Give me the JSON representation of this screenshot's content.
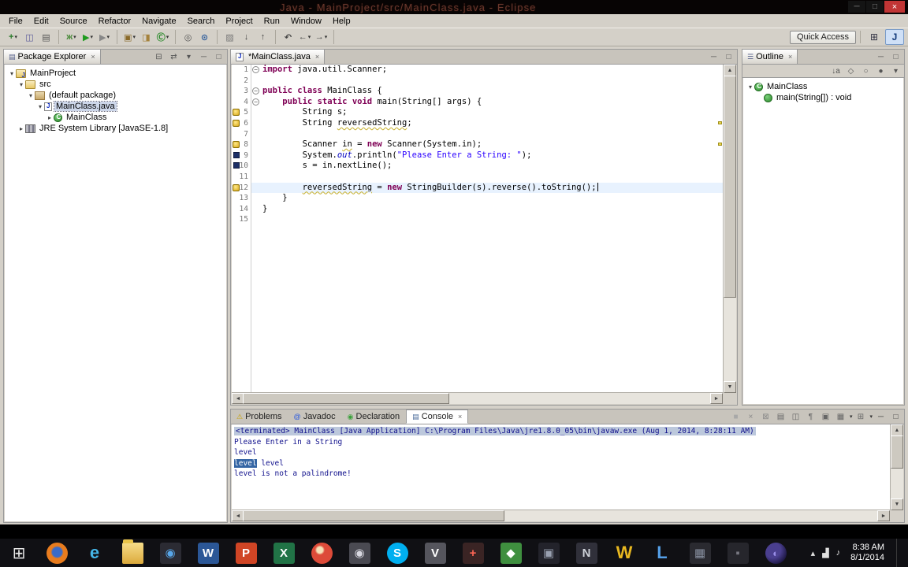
{
  "window": {
    "title": "Java - MainProject/src/MainClass.java - Eclipse",
    "controls": {
      "minimize": "─",
      "maximize": "□",
      "close": "×"
    }
  },
  "menu_bar": {
    "items": [
      "File",
      "Edit",
      "Source",
      "Refactor",
      "Navigate",
      "Search",
      "Project",
      "Run",
      "Window",
      "Help"
    ]
  },
  "toolbar": {
    "quick_access": "Quick Access",
    "perspectives": [
      {
        "name": "open-perspective",
        "glyph": "⊞",
        "active": false
      },
      {
        "name": "java-perspective",
        "glyph": "J",
        "active": true
      }
    ],
    "groups": [
      [
        {
          "name": "new-wizard",
          "glyph": "+",
          "fg": "#2a7a2a",
          "dd": true
        },
        {
          "name": "save",
          "glyph": "◫",
          "fg": "#5a5a9a"
        },
        {
          "name": "print",
          "glyph": "▤",
          "fg": "#555555"
        }
      ],
      [
        {
          "name": "debug",
          "glyph": "ж",
          "fg": "#4a8a3a",
          "dd": true
        },
        {
          "name": "run",
          "glyph": "▶",
          "fg": "#1e9a1e",
          "dd": true
        },
        {
          "name": "run-external-tools",
          "glyph": "▶",
          "fg": "#888888",
          "dd": true
        }
      ],
      [
        {
          "name": "new-java-project",
          "glyph": "▣",
          "fg": "#8a6a2a",
          "dd": true
        },
        {
          "name": "new-package",
          "glyph": "◨",
          "fg": "#a5823c"
        },
        {
          "name": "new-class",
          "glyph": "Ⓒ",
          "fg": "#2a8a2a",
          "dd": true
        }
      ],
      [
        {
          "name": "open-type",
          "glyph": "◎",
          "fg": "#555555"
        },
        {
          "name": "search",
          "glyph": "⊙",
          "fg": "#2a5a9a"
        }
      ],
      [
        {
          "name": "mark-occurrences",
          "glyph": "▨",
          "fg": "#777777"
        },
        {
          "name": "next-annotation",
          "glyph": "↓",
          "fg": "#444444"
        },
        {
          "name": "previous-annotation",
          "glyph": "↑",
          "fg": "#444444"
        }
      ],
      [
        {
          "name": "last-edit-location",
          "glyph": "↶",
          "fg": "#444444"
        },
        {
          "name": "back",
          "glyph": "←",
          "fg": "#444444",
          "dd": true
        },
        {
          "name": "forward",
          "glyph": "→",
          "fg": "#444444",
          "dd": true
        }
      ]
    ]
  },
  "package_explorer": {
    "title": "Package Explorer",
    "close_glyph": "×",
    "tab_icon": "▤",
    "header_icons": [
      {
        "name": "collapse-all",
        "glyph": "⊟"
      },
      {
        "name": "link-with-editor",
        "glyph": "⇄"
      },
      {
        "name": "view-menu",
        "glyph": "▾"
      },
      {
        "name": "minimize",
        "glyph": "─"
      },
      {
        "name": "maximize",
        "glyph": "□"
      }
    ],
    "tree": [
      {
        "label": "MainProject",
        "depth": 0,
        "arrow": "expanded",
        "icon": "project"
      },
      {
        "label": "src",
        "depth": 1,
        "arrow": "expanded",
        "icon": "src"
      },
      {
        "label": "(default package)",
        "depth": 2,
        "arrow": "expanded",
        "icon": "package"
      },
      {
        "label": "MainClass.java",
        "depth": 3,
        "arrow": "expanded",
        "icon": "java-file",
        "selected": true
      },
      {
        "label": "MainClass",
        "depth": 4,
        "arrow": "collapsed",
        "icon": "class"
      },
      {
        "label": "JRE System Library [JavaSE-1.8]",
        "depth": 1,
        "arrow": "collapsed",
        "icon": "library"
      }
    ]
  },
  "editor": {
    "tab_label": "*MainClass.java",
    "tab_close": "×",
    "header_icons": [
      {
        "name": "minimize",
        "glyph": "─"
      },
      {
        "name": "maximize",
        "glyph": "□"
      }
    ],
    "folds": [
      1,
      3,
      4
    ],
    "markers": [
      {
        "line": 5,
        "type": "warning"
      },
      {
        "line": 6,
        "type": "warning"
      },
      {
        "line": 8,
        "type": "warning"
      },
      {
        "line": 9,
        "type": "dot"
      },
      {
        "line": 10,
        "type": "dot"
      },
      {
        "line": 12,
        "type": "warning"
      }
    ],
    "lines": [
      {
        "n": 1,
        "tokens": [
          [
            "k",
            "import"
          ],
          [
            "p",
            " java.util.Scanner;"
          ]
        ]
      },
      {
        "n": 2,
        "tokens": []
      },
      {
        "n": 3,
        "tokens": [
          [
            "k",
            "public"
          ],
          [
            "p",
            " "
          ],
          [
            "k",
            "class"
          ],
          [
            "p",
            " MainClass {"
          ]
        ]
      },
      {
        "n": 4,
        "tokens": [
          [
            "p",
            "    "
          ],
          [
            "k",
            "public"
          ],
          [
            "p",
            " "
          ],
          [
            "k",
            "static"
          ],
          [
            "p",
            " "
          ],
          [
            "k",
            "void"
          ],
          [
            "p",
            " main(String[] args) {"
          ]
        ]
      },
      {
        "n": 5,
        "tokens": [
          [
            "p",
            "        String s;"
          ]
        ]
      },
      {
        "n": 6,
        "tokens": [
          [
            "p",
            "        String "
          ],
          [
            "w",
            "reversedString"
          ],
          [
            "p",
            ";"
          ]
        ]
      },
      {
        "n": 7,
        "tokens": []
      },
      {
        "n": 8,
        "tokens": [
          [
            "p",
            "        Scanner "
          ],
          [
            "w",
            "in"
          ],
          [
            "p",
            " = "
          ],
          [
            "k",
            "new"
          ],
          [
            "p",
            " Scanner(System.in);"
          ]
        ]
      },
      {
        "n": 9,
        "tokens": [
          [
            "p",
            "        System."
          ],
          [
            "f",
            "out"
          ],
          [
            "p",
            ".println("
          ],
          [
            "s",
            "\"Please Enter a String: \""
          ],
          [
            "p",
            ");"
          ]
        ]
      },
      {
        "n": 10,
        "tokens": [
          [
            "p",
            "        s = in.nextLine();"
          ]
        ]
      },
      {
        "n": 11,
        "tokens": []
      },
      {
        "n": 12,
        "tokens": [
          [
            "p",
            "        "
          ],
          [
            "w",
            "reversedString"
          ],
          [
            "p",
            " = "
          ],
          [
            "k",
            "new"
          ],
          [
            "p",
            " StringBuilder(s).reverse().toString();"
          ]
        ],
        "current": true,
        "caret": true
      },
      {
        "n": 13,
        "tokens": [
          [
            "p",
            "    }"
          ]
        ]
      },
      {
        "n": 14,
        "tokens": [
          [
            "p",
            "}"
          ]
        ]
      },
      {
        "n": 15,
        "tokens": []
      }
    ]
  },
  "outline": {
    "title": "Outline",
    "close_glyph": "×",
    "tab_icon": "☰",
    "header_icons": [
      {
        "name": "minimize",
        "glyph": "─"
      },
      {
        "name": "maximize",
        "glyph": "□"
      }
    ],
    "toolbar_icons": [
      {
        "name": "sort",
        "glyph": "↓a"
      },
      {
        "name": "hide-fields",
        "glyph": "◇"
      },
      {
        "name": "hide-static-members",
        "glyph": "○"
      },
      {
        "name": "hide-non-public-members",
        "glyph": "●"
      },
      {
        "name": "view-menu",
        "glyph": "▾"
      }
    ],
    "tree": [
      {
        "label": "MainClass",
        "depth": 0,
        "arrow": "expanded",
        "icon": "class"
      },
      {
        "label": "main(String[]) : void",
        "depth": 1,
        "arrow": "none",
        "icon": "method"
      }
    ]
  },
  "console": {
    "tabs": [
      {
        "label": "Problems",
        "icon": "⚠",
        "icon_color": "#c8a000"
      },
      {
        "label": "Javadoc",
        "icon": "@",
        "icon_color": "#2a5adf"
      },
      {
        "label": "Declaration",
        "icon": "◉",
        "icon_color": "#3aa03a"
      },
      {
        "label": "Console",
        "icon": "▤",
        "icon_color": "#4a6a9a",
        "active": true,
        "closable": true
      }
    ],
    "toolbar_icons": [
      {
        "name": "terminate",
        "glyph": "■",
        "fg": "#a8a8a8"
      },
      {
        "name": "remove-launch",
        "glyph": "×",
        "fg": "#888888"
      },
      {
        "name": "remove-all-launches",
        "glyph": "⊠",
        "fg": "#888888"
      },
      {
        "name": "clear-console",
        "glyph": "▤",
        "fg": "#666666"
      },
      {
        "name": "scroll-lock",
        "glyph": "◫",
        "fg": "#666666"
      },
      {
        "name": "word-wrap",
        "glyph": "¶",
        "fg": "#666666"
      },
      {
        "name": "pin-console",
        "glyph": "▣",
        "fg": "#666666"
      },
      {
        "name": "display-selected-console",
        "glyph": "▦",
        "fg": "#666666",
        "dd": true
      },
      {
        "name": "open-console",
        "glyph": "⊞",
        "fg": "#666666",
        "dd": true
      },
      {
        "name": "minimize",
        "glyph": "─",
        "fg": "#444444"
      },
      {
        "name": "maximize",
        "glyph": "□",
        "fg": "#444444"
      }
    ],
    "header": "<terminated> MainClass [Java Application] C:\\Program Files\\Java\\jre1.8.0_05\\bin\\javaw.exe (Aug 1, 2014, 8:28:11 AM)",
    "lines": [
      {
        "text": "Please Enter in a String"
      },
      {
        "text": "level"
      },
      {
        "selected": "level",
        "rest": " level"
      },
      {
        "text": "level is not a palindrome!"
      }
    ]
  },
  "taskbar": {
    "time": "8:38 AM",
    "date": "8/1/2014",
    "apps": [
      {
        "id": "start",
        "cls": "app-start",
        "glyph": "⊞"
      },
      {
        "id": "firefox",
        "cls": "app-firefox",
        "glyph": ""
      },
      {
        "id": "internet-explorer",
        "glyph": "e",
        "fg": "#45b6e8",
        "bg": "none",
        "big": true
      },
      {
        "id": "file-explorer",
        "cls": "app-folder",
        "glyph": ""
      },
      {
        "id": "media-player",
        "glyph": "◉",
        "fg": "#58a6e8",
        "bg": "#2b2b33"
      },
      {
        "id": "word",
        "glyph": "W",
        "fg": "#ffffff",
        "bg": "#2b5797"
      },
      {
        "id": "powerpoint",
        "glyph": "P",
        "fg": "#ffffff",
        "bg": "#d04525"
      },
      {
        "id": "excel",
        "glyph": "X",
        "fg": "#ffffff",
        "bg": "#217346"
      },
      {
        "id": "chrome",
        "cls": "app-chrome",
        "glyph": ""
      },
      {
        "id": "camera",
        "glyph": "◉",
        "fg": "#d8d8e0",
        "bg": "#4a4a52"
      },
      {
        "id": "skype",
        "glyph": "S",
        "fg": "#ffffff",
        "bg": "#00aff0",
        "circle": true
      },
      {
        "id": "vlc",
        "glyph": "V",
        "fg": "#ffffff",
        "bg": "#55555d"
      },
      {
        "id": "red-cross-app",
        "glyph": "+",
        "fg": "#ff6655",
        "bg": "#3a2424"
      },
      {
        "id": "green-app",
        "glyph": "◆",
        "fg": "#ffffff",
        "bg": "#3f8f3f"
      },
      {
        "id": "dark-app-1",
        "glyph": "▣",
        "fg": "#99a0b0",
        "bg": "#23232b"
      },
      {
        "id": "notepad",
        "glyph": "N",
        "fg": "#cfd3da",
        "bg": "#30303a"
      },
      {
        "id": "winamp",
        "glyph": "W",
        "fg": "#e8b820",
        "bg": "none",
        "big": true
      },
      {
        "id": "blue-l-app",
        "glyph": "L",
        "fg": "#55a0e8",
        "bg": "none",
        "big": true
      },
      {
        "id": "dark-app-2",
        "glyph": "▦",
        "fg": "#8890a0",
        "bg": "#2a2a30"
      },
      {
        "id": "dark-app-3",
        "glyph": "▪",
        "fg": "#777780",
        "bg": "#26262c"
      },
      {
        "id": "eclipse",
        "cls": "app-eclipse",
        "glyph": "◐"
      }
    ],
    "tray_icons": [
      {
        "id": "show-hidden",
        "glyph": "▴"
      },
      {
        "id": "network",
        "glyph": "▟"
      },
      {
        "id": "volume",
        "glyph": "♪"
      }
    ]
  }
}
